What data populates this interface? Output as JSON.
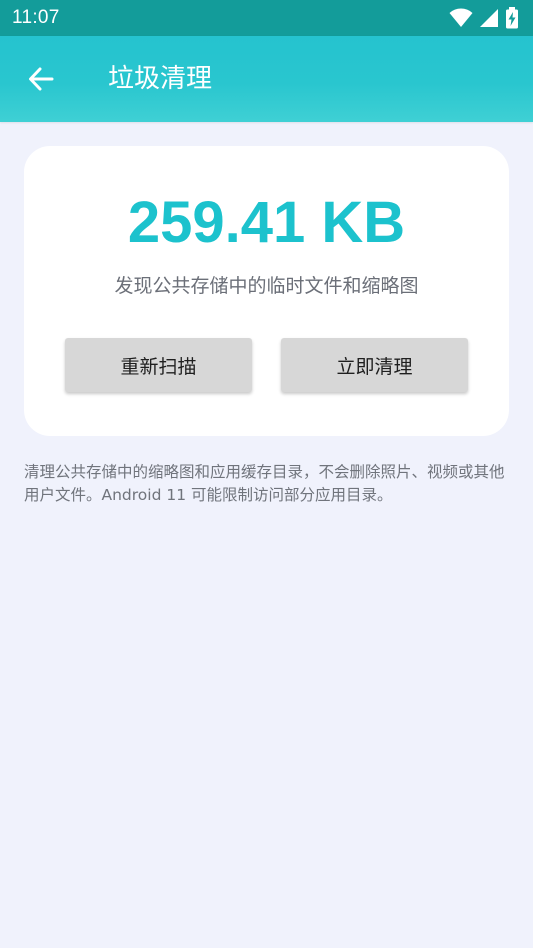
{
  "status_bar": {
    "time": "11:07",
    "icons": [
      "wifi-icon",
      "cell-signal-icon",
      "battery-charging-icon"
    ]
  },
  "app_bar": {
    "back_icon": "arrow-left-icon",
    "title": "垃圾清理",
    "color": "#29c6cf"
  },
  "summary": {
    "size_value": "259.41 KB",
    "size_color": "#1cc2cd",
    "description": "发现公共存储中的临时文件和缩略图"
  },
  "actions": {
    "rescan_label": "重新扫描",
    "clean_label": "立即清理"
  },
  "note": "清理公共存储中的缩略图和应用缓存目录，不会删除照片、视频或其他用户文件。Android 11 可能限制访问部分应用目录。"
}
